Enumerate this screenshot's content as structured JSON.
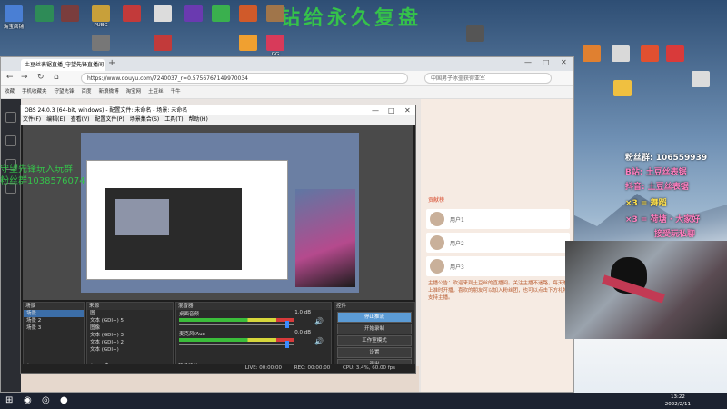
{
  "desktop": {
    "watermark": "钻给永久复盘",
    "icons": [
      {
        "label": "淘宝店铺",
        "color": "#4a7fd4"
      },
      {
        "label": "",
        "color": "#2e8b57"
      },
      {
        "label": "",
        "color": "#7a3d3d"
      },
      {
        "label": "PUBG",
        "color": "#c8a03a"
      },
      {
        "label": "",
        "color": "#c23a3a"
      },
      {
        "label": "",
        "color": "#dcdcdc"
      },
      {
        "label": "",
        "color": "#6a3ab0"
      },
      {
        "label": "",
        "color": "#3ab04e"
      },
      {
        "label": "",
        "color": "#d05a2a"
      },
      {
        "label": "",
        "color": "#a0754a"
      },
      {
        "label": "",
        "color": "#777777"
      },
      {
        "label": "",
        "color": "#c23a3a"
      },
      {
        "label": "",
        "color": "#f0a030"
      },
      {
        "label": "GG",
        "color": "#d83a5a"
      },
      {
        "label": "",
        "color": "#555555"
      },
      {
        "label": "",
        "color": "#e08030"
      },
      {
        "label": "",
        "color": "#d9d9d9"
      },
      {
        "label": "",
        "color": "#e05030"
      },
      {
        "label": "",
        "color": "#d93a3a"
      },
      {
        "label": "",
        "color": "#f0c040"
      },
      {
        "label": "",
        "color": "#dcdcdc"
      }
    ]
  },
  "browser": {
    "tab_title": "土豆丝表锯直播_守望先锋直播间",
    "new_tab": "+",
    "url": "https://www.douyu.com/7240037_r=0.5756767149970034",
    "search_placeholder": "中国男子冰壶获得亚军",
    "bookmarks": [
      "收藏",
      "手机收藏夹",
      "守望先锋",
      "百度",
      "新浪微博",
      "淘宝网",
      "土豆丝",
      "千牛"
    ]
  },
  "obs": {
    "title": "OBS 24.0.3 (64-bit, windows) - 配置文件: 未命名 - 场景: 未命名",
    "menu": [
      "文件(F)",
      "编辑(E)",
      "查看(V)",
      "配置文件(P)",
      "场景集合(S)",
      "工具(T)",
      "帮助(H)"
    ],
    "scenes_header": "场景",
    "scenes": [
      "场景",
      "场景 2",
      "场景 3"
    ],
    "sources_header": "来源",
    "sources": [
      "图",
      "文本 (GDI+) 5",
      "图像",
      "文本 (GDI+) 3",
      "文本 (GDI+) 2",
      "文本 (GDI+)"
    ],
    "mixer_header": "混音器",
    "mixer": [
      {
        "name": "桌面音频",
        "db": "1.0 dB"
      },
      {
        "name": "麦克风/Aux",
        "db": "0.0 dB"
      }
    ],
    "transitions_label": "转场特效",
    "controls_header": "控件",
    "controls": [
      "停止推流",
      "开始录制",
      "工作室模式",
      "设置",
      "退出"
    ],
    "status": {
      "live": "LIVE: 00:00:00",
      "rec": "REC: 00:00:00",
      "cpu": "CPU: 3.4%, 60.00 fps"
    }
  },
  "douyu": {
    "ranking_label": "贡献榜",
    "chat_users": [
      "用户1",
      "用户2",
      "用户3"
    ],
    "notice": "主播公告：欢迎来到土豆丝的直播间。关注主播不迷路，每天晚上准时开播，喜欢的朋友可以加入粉丝团，也可以点击下方礼物支持主播。"
  },
  "overlay": {
    "lines": [
      {
        "text": "粉丝群: 106559939",
        "color": "#ffffff"
      },
      {
        "text": "B站: 土豆丝表锯",
        "color": "#ff7fc0"
      },
      {
        "text": "抖音: 土豆丝表锯",
        "color": "#ff7fc0"
      },
      {
        "text": "×3 = 舞蹈",
        "color": "#ffe14d"
      },
      {
        "text": "×3 = 荷塘 · 大家好",
        "color": "#ff7fc0"
      },
      {
        "text": "接受玩私聊",
        "color": "#ff7fc0"
      }
    ],
    "left_text": [
      "守望先锋玩入玩群",
      "粉丝群1038576074"
    ]
  },
  "taskbar": {
    "time": "13:22",
    "date": "2022/2/11"
  }
}
